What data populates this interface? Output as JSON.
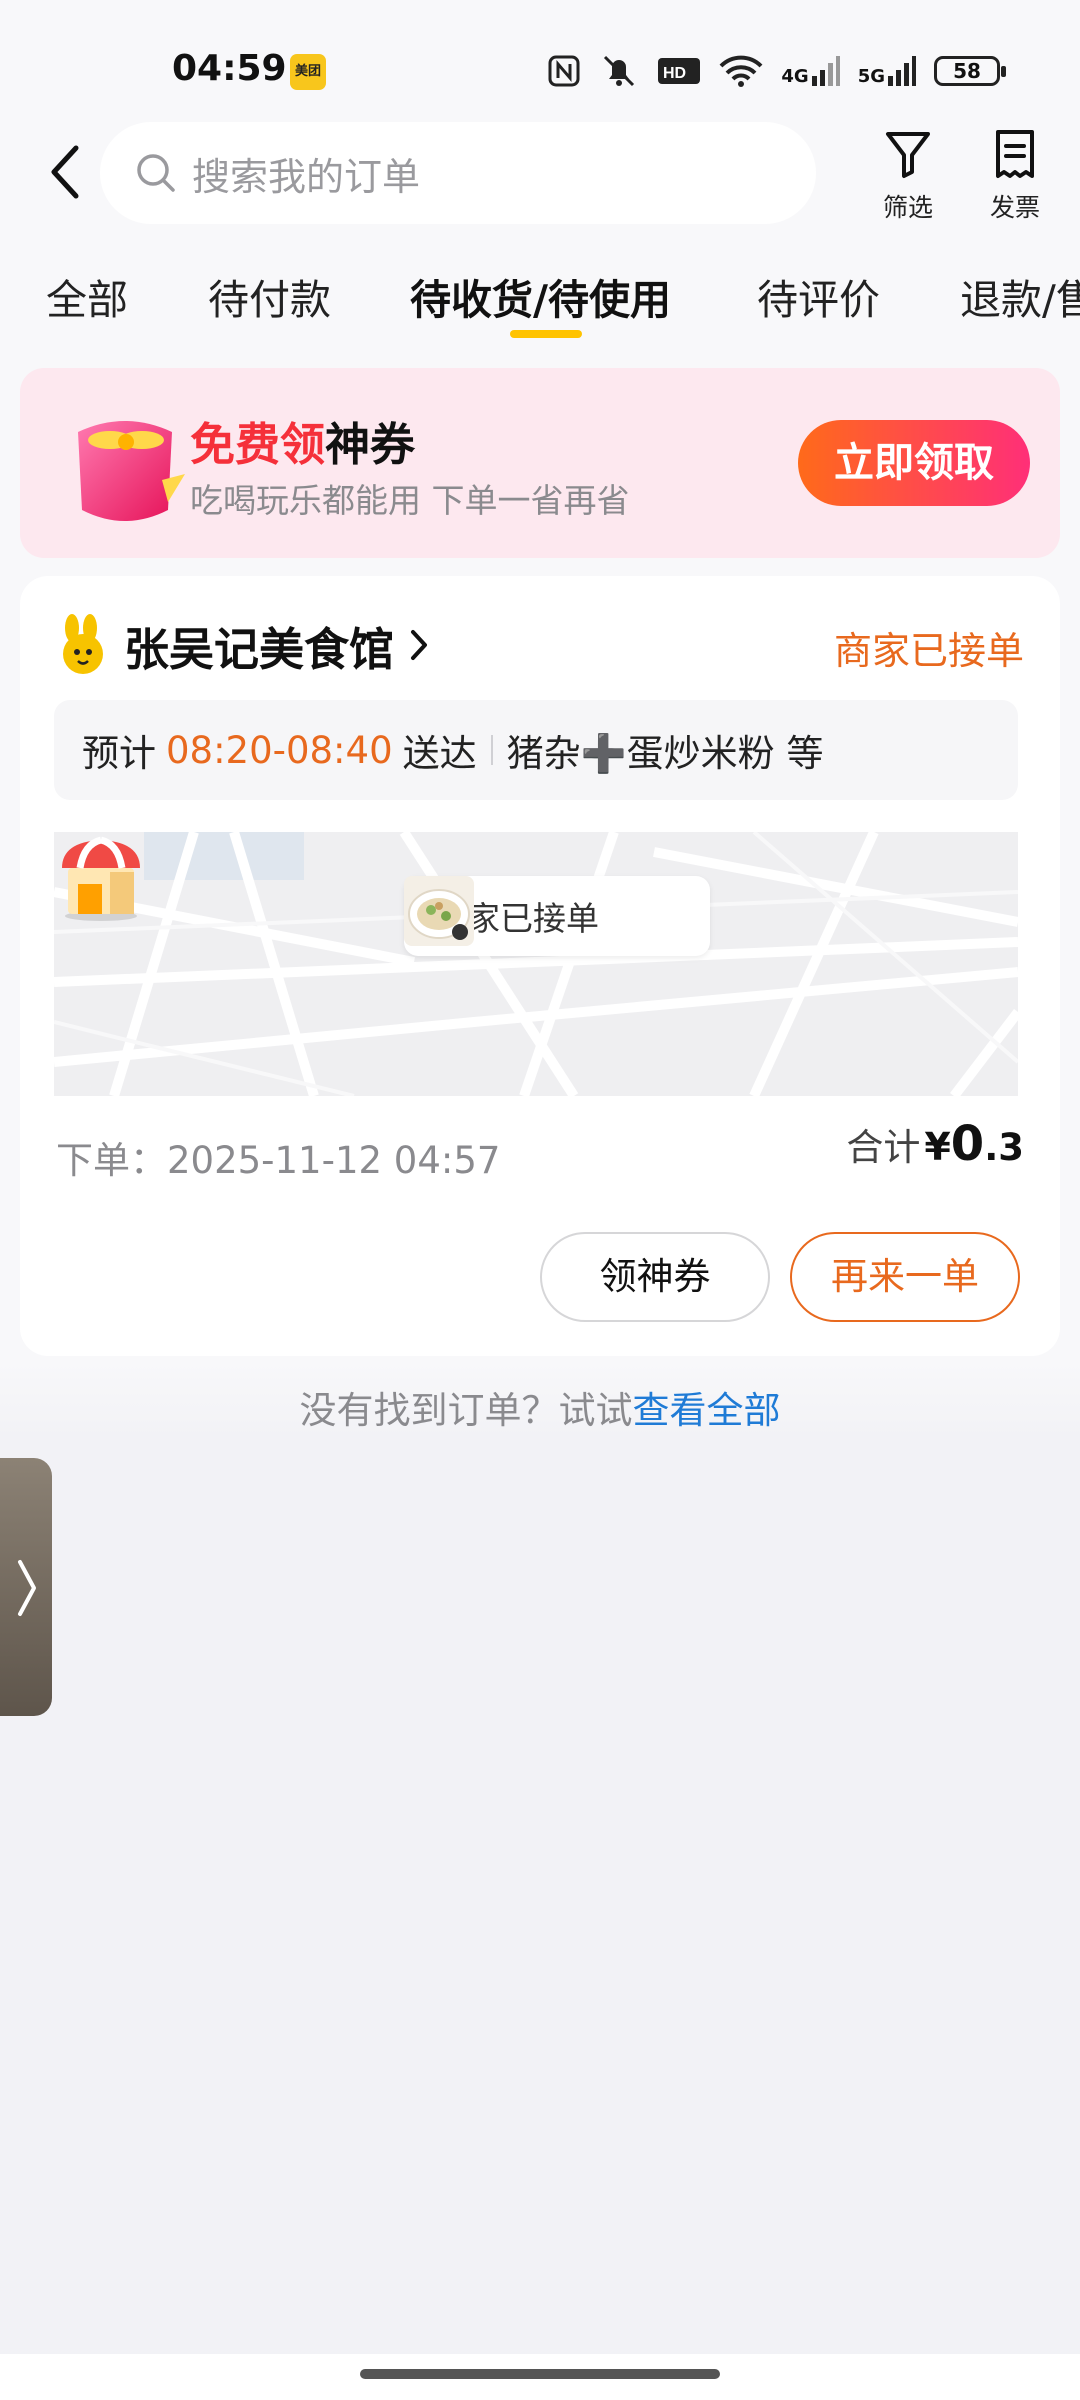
{
  "status_bar": {
    "time": "04:59",
    "app_badge": "美团",
    "network_1": "4G",
    "network_2": "5G",
    "battery": "58"
  },
  "header": {
    "search_placeholder": "搜索我的订单",
    "filter_label": "筛选",
    "invoice_label": "发票"
  },
  "tabs": [
    {
      "label": "全部",
      "active": false
    },
    {
      "label": "待付款",
      "active": false
    },
    {
      "label": "待收货/待使用",
      "active": true
    },
    {
      "label": "待评价",
      "active": false
    },
    {
      "label": "退款/售后",
      "active": false
    }
  ],
  "promo": {
    "title_highlight": "免费领",
    "title_rest": "神券",
    "subtitle": "吃喝玩乐都能用 下单一省再省",
    "button": "立即领取"
  },
  "order": {
    "store_name": "张吴记美食馆",
    "status": "商家已接单",
    "eta_prefix": "预计",
    "eta_time": "08:20-08:40",
    "eta_suffix": "送达",
    "items": "猪杂➕蛋炒米粉 等",
    "map_bubble": "商家已接单",
    "order_time": "下单：2025-11-12 04:57",
    "total_label": "合计",
    "currency": "¥",
    "amount_int": "0",
    "amount_dec": ".3",
    "btn_coupon": "领神券",
    "btn_reorder": "再来一单"
  },
  "footer": {
    "not_found": "没有找到订单？试试",
    "view_all": "查看全部"
  },
  "colors": {
    "accent_orange": "#e8691e",
    "tab_underline": "#ffc300",
    "link_blue": "#1f7bd6",
    "promo_bg": "#fde8ef"
  }
}
